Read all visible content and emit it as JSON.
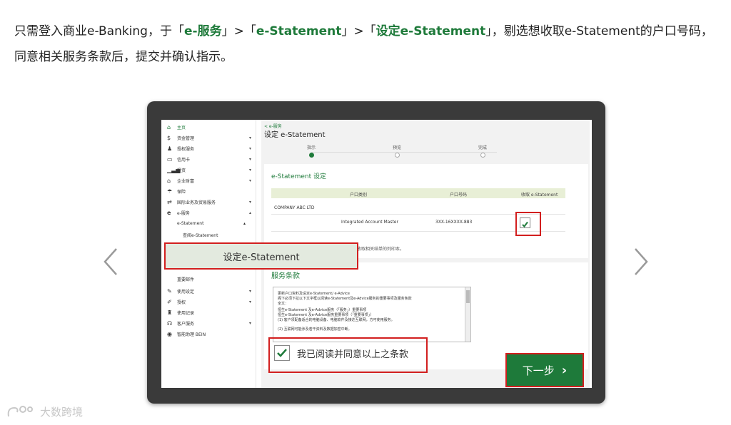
{
  "intro": {
    "p1": "只需登入商业e-Banking，于「",
    "hl1": "e-服务",
    "p2": "」>「",
    "hl2": "e-Statement",
    "p3": "」>「",
    "hl3": "设定e-Statement",
    "p4": "」，剔选想收取e-Statement的户口号码，同意相关服务条款后，提交并确认指示。"
  },
  "sidebar": {
    "items": [
      {
        "icon": "home-icon",
        "label": "主页"
      },
      {
        "icon": "dollar-icon",
        "label": "资金管理"
      },
      {
        "icon": "person-icon",
        "label": "授权服务"
      },
      {
        "icon": "card-icon",
        "label": "信用卡"
      },
      {
        "icon": "chart-icon",
        "label": "投资"
      },
      {
        "icon": "building-icon",
        "label": "企业财富"
      },
      {
        "icon": "umbrella-icon",
        "label": "保险"
      },
      {
        "icon": "exchange-icon",
        "label": "国际业务及贸易服务"
      },
      {
        "icon": "e-icon",
        "label": "e-服务"
      }
    ],
    "sub_estatement": "e-Statement",
    "sub_query": "查阅e-Statement",
    "sub_mail": "重要邮件",
    "items2": [
      {
        "icon": "wrench-icon",
        "label": "使用设定"
      },
      {
        "icon": "pencil-icon",
        "label": "授权"
      },
      {
        "icon": "bank-icon",
        "label": "使用记录"
      },
      {
        "icon": "headset-icon",
        "label": "客户服务"
      },
      {
        "icon": "robot-icon",
        "label": "智能助理 BEIN"
      }
    ]
  },
  "main": {
    "breadcrumb": "< e-服务",
    "title": "设定 e-Statement",
    "steps": [
      "指示",
      "预览",
      "完成"
    ],
    "card1_title": "e-Statement 设定",
    "table_headers": [
      "户口类别",
      "户口号码",
      "收取 e-Statement"
    ],
    "company": "COMPANY ABC LTD",
    "account_type": "Integrated Account Master",
    "account_no": "3XX-16XXXX-883",
    "note": "收取相关结单的列印本。",
    "card2_title": "服务条款",
    "terms_lines": [
      "更新户口资料及设定e-Statement/ e-Advice",
      "阁下必须下拉以下文字框以阅读e-Statement及e-Advice服务的重要事项及服务条款",
      "全文：",
      "恒生e-Statement 及e-Advice服务（「服务」）重要事项",
      "恒生e-Statement 及e-Advice服务重要事项（「重要事项」）",
      "(1) 客户须配备适合的电脑设备、电脑软件及接达互联网，方可使用服务。",
      "(2) 互联网可能涉及若干资料及数据加密中断。"
    ],
    "agree_text": "我已阅读并同意以上之条款",
    "next_label": "下一步",
    "next_arrow": "›"
  },
  "overlay_label": "设定e-Statement",
  "watermark": "大数跨境",
  "colors": {
    "brand_green": "#1e7a3a",
    "highlight_red": "#d21f1f"
  }
}
